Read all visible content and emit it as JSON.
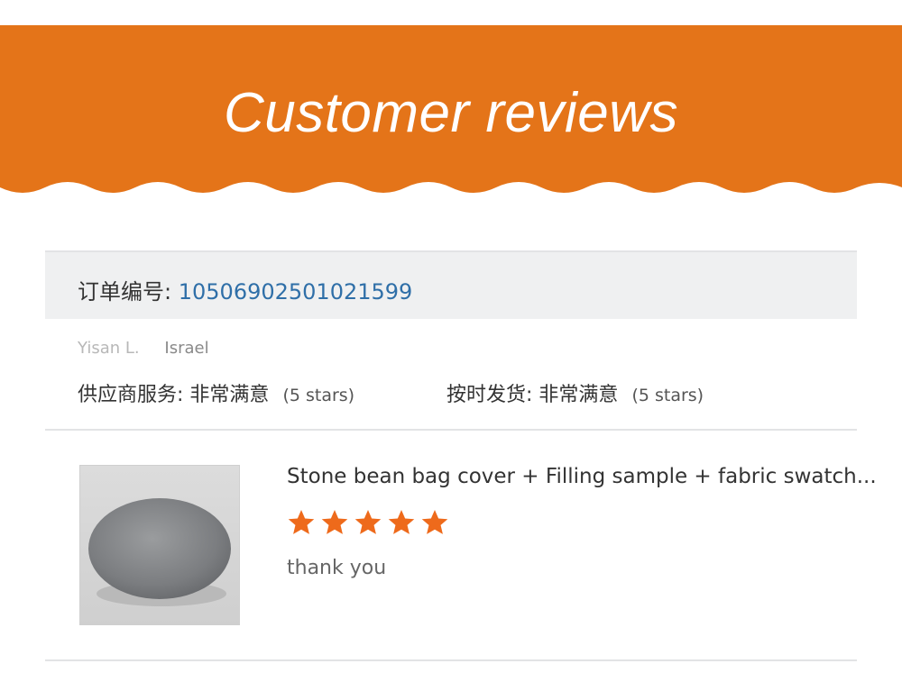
{
  "banner": {
    "title": "Customer reviews",
    "color": "#e47419"
  },
  "order": {
    "label": "订单编号:",
    "number": "10506902501021599",
    "number_color": "#2f6fa8"
  },
  "buyer": {
    "name": "Yisan L.",
    "country": "Israel"
  },
  "ratings": [
    {
      "label": "供应商服务:",
      "value": "非常满意",
      "stars_text": "(5 stars)"
    },
    {
      "label": "按时发货:",
      "value": "非常满意",
      "stars_text": "(5 stars)"
    }
  ],
  "product": {
    "title": "Stone bean bag cover + Filling sample + fabric swatch...",
    "rating": 5,
    "star_color": "#ee6a1b",
    "comment": "thank you"
  }
}
